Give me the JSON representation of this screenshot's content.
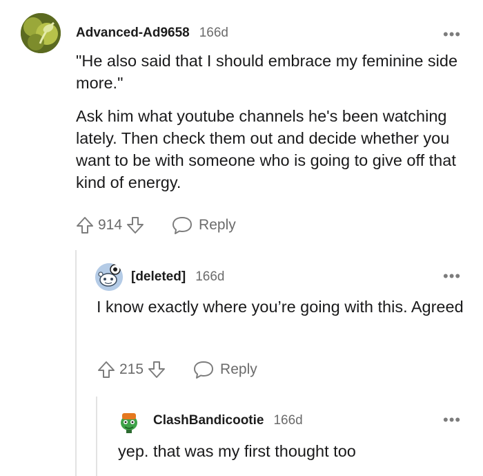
{
  "comments": [
    {
      "username": "Advanced-Ad9658",
      "age": "166d",
      "paragraphs": [
        "\"He also said that I should embrace my feminine side more.\"",
        "Ask him what youtube channels he's been watching lately. Then check them out and decide whether you want to be with someone who is going to give off that kind of energy."
      ],
      "score": "914",
      "reply_label": "Reply",
      "more": "•••",
      "avatar_icon": "leaf-avatar-icon"
    },
    {
      "username": "[deleted]",
      "age": "166d",
      "paragraphs": [
        "I know exactly where you’re going with this. Agreed"
      ],
      "score": "215",
      "reply_label": "Reply",
      "more": "•••",
      "avatar_icon": "snoo-avatar-icon"
    },
    {
      "username": "ClashBandicootie",
      "age": "166d",
      "paragraphs": [
        "yep. that was my first thought too"
      ],
      "more": "•••",
      "avatar_icon": "frog-avatar-icon"
    }
  ],
  "colors": {
    "text": "#1a1a1b",
    "muted": "#7c7c7c",
    "thread_line": "#e2e2e2"
  }
}
